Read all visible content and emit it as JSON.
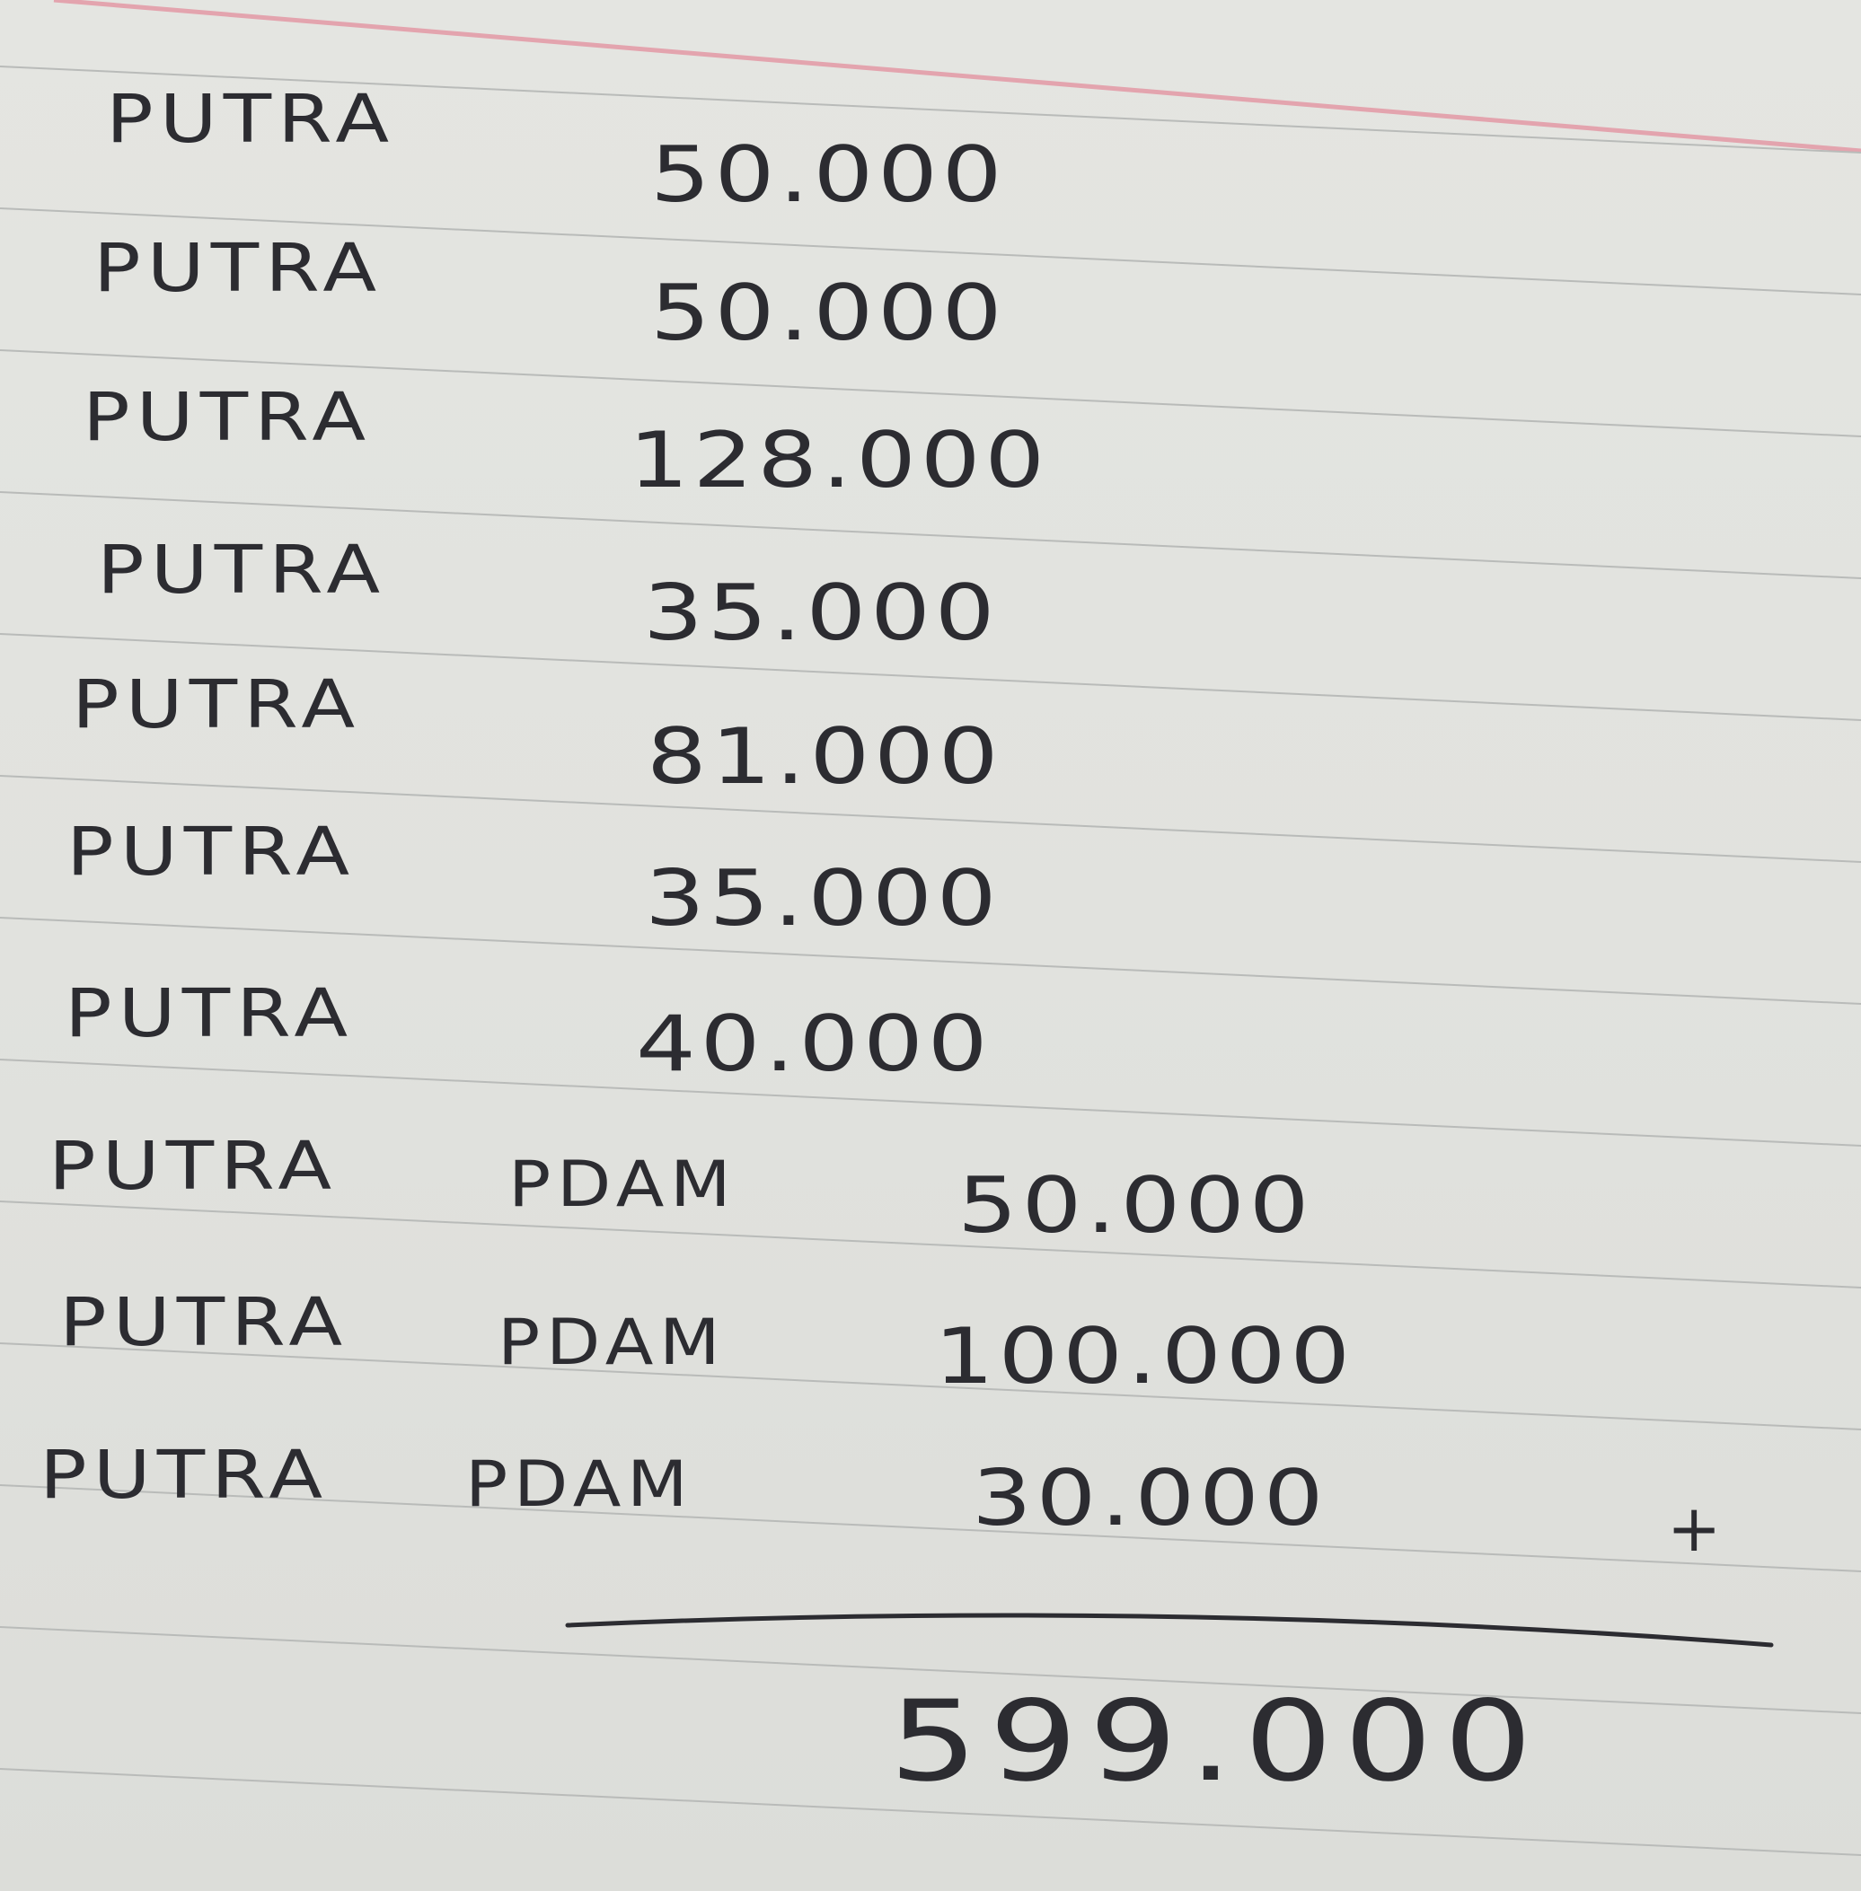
{
  "entries": [
    {
      "name": "PUTRA",
      "memo": "",
      "amount": "50.000"
    },
    {
      "name": "PUTRA",
      "memo": "",
      "amount": "50.000"
    },
    {
      "name": "PUTRA",
      "memo": "",
      "amount": "128.000"
    },
    {
      "name": "PUTRA",
      "memo": "",
      "amount": "35.000"
    },
    {
      "name": "PUTRA",
      "memo": "",
      "amount": "81.000"
    },
    {
      "name": "PUTRA",
      "memo": "",
      "amount": "35.000"
    },
    {
      "name": "PUTRA",
      "memo": "",
      "amount": "40.000"
    },
    {
      "name": "PUTRA",
      "memo": "PDAM",
      "amount": "50.000"
    },
    {
      "name": "PUTRA",
      "memo": "PDAM",
      "amount": "100.000"
    },
    {
      "name": "PUTRA",
      "memo": "PDAM",
      "amount": "30.000"
    }
  ],
  "plus_sign": "+",
  "total": "599.000",
  "colors": {
    "paper": "#e1e2de",
    "rule": "#b9bbb9",
    "margin_rule": "#e3a4ae",
    "ink": "#2c2c31"
  }
}
